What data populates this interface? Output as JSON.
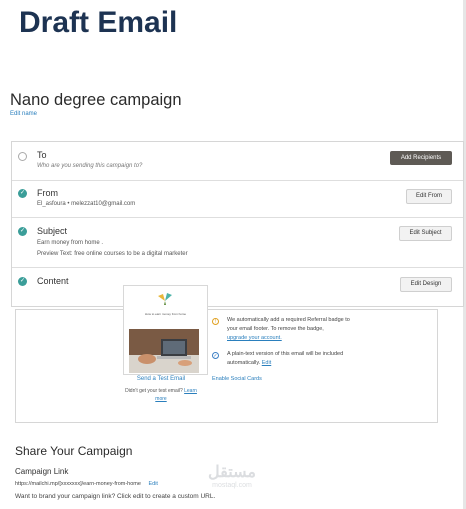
{
  "slide_title": "Draft Email",
  "campaign": {
    "name": "Nano degree campaign",
    "edit_name_link": "Edit name"
  },
  "checklist": {
    "to": {
      "title": "To",
      "subtitle": "Who are you sending this campaign to?",
      "button": "Add Recipients",
      "complete": false
    },
    "from": {
      "title": "From",
      "value": "El_asfoura • melezzat10@gmail.com",
      "button": "Edit From",
      "complete": true
    },
    "subject": {
      "title": "Subject",
      "value": "Earn money from home .",
      "preview_text": "Preview Text: free online courses to be a digital marketer",
      "button": "Edit Subject",
      "complete": true
    },
    "content": {
      "title": "Content",
      "button": "Edit Design",
      "complete": true
    }
  },
  "content_panel": {
    "preview_caption": "How to earn money from home",
    "send_test": "Send a Test Email",
    "no_email_text": "Didn't get your test email?",
    "learn_more": "Learn more",
    "referral_notice_1": "We automatically add a required Referral badge to",
    "referral_notice_2": "your email footer. To remove the badge,",
    "referral_link": "upgrade your account.",
    "plaintext_notice_1": "A plain-text version of this email will be included",
    "plaintext_notice_2": "automatically.",
    "plaintext_edit": "Edit",
    "enable_social": "Enable Social Cards",
    "warn_icon": "!",
    "ok_icon": "✓"
  },
  "share": {
    "heading": "Share Your Campaign",
    "link_label": "Campaign Link",
    "url": "https://mailchi.mp/[xxxxxxx]/earn-money-from-home",
    "edit_link": "Edit",
    "brand_text": "Want to brand your campaign link? Click edit to create a custom URL."
  },
  "watermark": {
    "arabic": "مستقل",
    "domain": "mostaql.com"
  },
  "colors": {
    "title": "#1d3352",
    "check": "#3b9e99",
    "link": "#2a7fbd",
    "dark_button": "#5e5a55"
  }
}
